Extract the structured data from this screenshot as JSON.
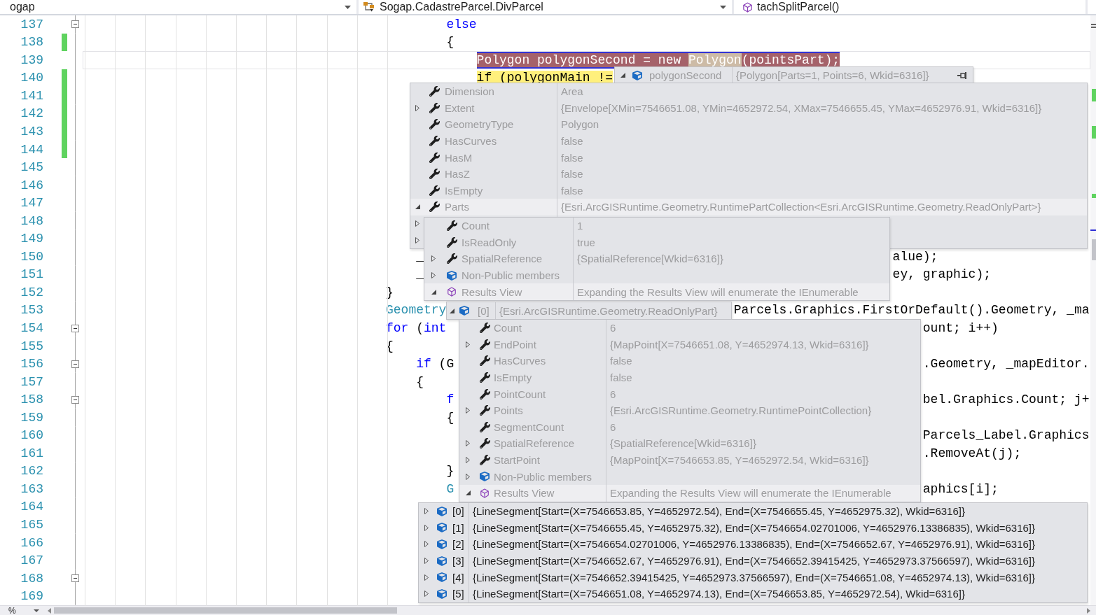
{
  "navbar": [
    {
      "label": "ogap"
    },
    {
      "label": "Sogap.CadastreParcel.DivParcel"
    },
    {
      "label": "tachSplitParcel()"
    }
  ],
  "editor": {
    "lines": [
      {
        "number": "137",
        "changed": false,
        "fold": true,
        "current": false,
        "tokens": [
          {
            "text": "                                                else",
            "kind": "keyword"
          }
        ]
      },
      {
        "number": "138",
        "changed": true,
        "fold": false,
        "current": false,
        "tokens": [
          {
            "text": "                                                {",
            "kind": "plain"
          }
        ]
      },
      {
        "number": "139",
        "changed": false,
        "fold": false,
        "current": true,
        "tokens": [
          {
            "text": "                                                    Polygon polygonSecond = new ",
            "kind": "statement"
          },
          {
            "text": "Polygon",
            "kind": "reference"
          },
          {
            "text": "(pointsPart);",
            "kind": "statement"
          }
        ]
      },
      {
        "number": "140",
        "changed": true,
        "fold": false,
        "current": false,
        "tokens": [
          {
            "text": "                                                    if (polygonMain !=",
            "kind": "current"
          }
        ]
      },
      {
        "number": "141",
        "changed": true,
        "fold": false,
        "current": false
      },
      {
        "number": "142",
        "changed": true,
        "fold": false,
        "current": false
      },
      {
        "number": "143",
        "changed": true,
        "fold": false,
        "current": false
      },
      {
        "number": "144",
        "changed": true,
        "fold": false,
        "current": false
      },
      {
        "number": "145",
        "changed": false,
        "fold": false,
        "current": false
      },
      {
        "number": "146",
        "changed": false,
        "fold": false,
        "current": false
      },
      {
        "number": "147",
        "changed": false,
        "fold": false,
        "current": false
      },
      {
        "number": "148",
        "changed": false,
        "fold": false,
        "current": false
      },
      {
        "number": "149",
        "changed": false,
        "fold": false,
        "current": false
      },
      {
        "number": "150",
        "changed": false,
        "fold": false,
        "current": false,
        "tokens": [
          {
            "text": "                                            _",
            "kind": "plain"
          },
          {
            "text": "                                                              alue);",
            "kind": "plain"
          }
        ]
      },
      {
        "number": "151",
        "changed": false,
        "fold": false,
        "current": false,
        "tokens": [
          {
            "text": "                                            _",
            "kind": "plain"
          },
          {
            "text": "                                                              ey, graphic);",
            "kind": "plain"
          }
        ]
      },
      {
        "number": "152",
        "changed": false,
        "fold": false,
        "current": false,
        "tokens": [
          {
            "text": "                                        }",
            "kind": "plain"
          }
        ]
      },
      {
        "number": "153",
        "changed": false,
        "fold": false,
        "current": false,
        "tokens": [
          {
            "text": "                                        Geometry",
            "kind": "type"
          },
          {
            "text": "                                      Parcels.Graphics.FirstOrDefault().Geometry, _ma",
            "kind": "plain"
          }
        ]
      },
      {
        "number": "154",
        "changed": false,
        "fold": true,
        "current": false,
        "tokens": [
          {
            "text": "                                        for",
            "kind": "keyword"
          },
          {
            "text": " (",
            "kind": "plain"
          },
          {
            "text": "int",
            "kind": "keyword"
          },
          {
            "text": "                                                               ount; i++)",
            "kind": "plain"
          }
        ]
      },
      {
        "number": "155",
        "changed": false,
        "fold": false,
        "current": false,
        "tokens": [
          {
            "text": "                                        {",
            "kind": "plain"
          }
        ]
      },
      {
        "number": "156",
        "changed": false,
        "fold": true,
        "current": false,
        "tokens": [
          {
            "text": "                                            if",
            "kind": "keyword"
          },
          {
            "text": " (G",
            "kind": "plain"
          },
          {
            "text": "                                                              .Geometry, _mapEditor.",
            "kind": "plain"
          }
        ]
      },
      {
        "number": "157",
        "changed": false,
        "fold": false,
        "current": false,
        "tokens": [
          {
            "text": "                                            {",
            "kind": "plain"
          }
        ]
      },
      {
        "number": "158",
        "changed": false,
        "fold": true,
        "current": false,
        "tokens": [
          {
            "text": "                                                f",
            "kind": "keyword"
          },
          {
            "text": "                                                              bel.Graphics.Count; j+",
            "kind": "plain"
          }
        ]
      },
      {
        "number": "159",
        "changed": false,
        "fold": false,
        "current": false,
        "tokens": [
          {
            "text": "                                                {",
            "kind": "plain"
          }
        ]
      },
      {
        "number": "160",
        "changed": false,
        "fold": false,
        "current": false,
        "tokens": [
          {
            "text": "                                                                                                               Parcels_Label.Graphics",
            "kind": "plain"
          }
        ]
      },
      {
        "number": "161",
        "changed": false,
        "fold": false,
        "current": false,
        "tokens": [
          {
            "text": "                                                                                                               .RemoveAt(j);",
            "kind": "plain"
          }
        ]
      },
      {
        "number": "162",
        "changed": false,
        "fold": false,
        "current": false,
        "tokens": [
          {
            "text": "                                                }",
            "kind": "plain"
          }
        ]
      },
      {
        "number": "163",
        "changed": false,
        "fold": false,
        "current": false,
        "tokens": [
          {
            "text": "                                                G",
            "kind": "type"
          },
          {
            "text": "                                                              aphics[i];",
            "kind": "plain"
          }
        ]
      },
      {
        "number": "164",
        "changed": false,
        "fold": false,
        "current": false
      },
      {
        "number": "165",
        "changed": false,
        "fold": false,
        "current": false
      },
      {
        "number": "166",
        "changed": false,
        "fold": false,
        "current": false
      },
      {
        "number": "167",
        "changed": false,
        "fold": false,
        "current": false
      },
      {
        "number": "168",
        "changed": false,
        "fold": true,
        "current": false
      },
      {
        "number": "169",
        "changed": false,
        "fold": false,
        "current": false
      }
    ]
  },
  "datatips": [
    {
      "kind": "header",
      "faded": true,
      "expanded": true,
      "name": "polygonSecond",
      "value": "{Polygon[Parts=1, Points=6, Wkid=6316]}",
      "pin": true
    },
    {
      "kind": "list",
      "faded": true,
      "rows": [
        {
          "kind": "property",
          "name": "Dimension",
          "value": "Area"
        },
        {
          "kind": "property",
          "expanded": false,
          "name": "Extent",
          "value": "{Envelope[XMin=7546651.08, YMin=4652972.54, XMax=7546655.45, YMax=4652976.91, Wkid=6316]}"
        },
        {
          "kind": "property",
          "name": "GeometryType",
          "value": "Polygon"
        },
        {
          "kind": "property",
          "name": "HasCurves",
          "value": "false"
        },
        {
          "kind": "property",
          "name": "HasM",
          "value": "false"
        },
        {
          "kind": "property",
          "name": "HasZ",
          "value": "false"
        },
        {
          "kind": "property",
          "name": "IsEmpty",
          "value": "false"
        },
        {
          "kind": "property",
          "expanded": true,
          "name": "Parts",
          "value": "{Esri.ArcGISRuntime.Geometry.RuntimePartCollection<Esri.ArcGISRuntime.Geometry.ReadOnlyPart>}"
        },
        {
          "kind": "hidden",
          "expanded": false
        },
        {
          "kind": "hidden",
          "expanded": false
        }
      ]
    },
    {
      "kind": "list",
      "faded": true,
      "rows": [
        {
          "kind": "property",
          "name": "Count",
          "value": "1"
        },
        {
          "kind": "property",
          "name": "IsReadOnly",
          "value": "true"
        },
        {
          "kind": "property",
          "expanded": false,
          "name": "SpatialReference",
          "value": "{SpatialReference[Wkid=6316]}"
        },
        {
          "kind": "object",
          "expanded": false,
          "name": "Non-Public members"
        },
        {
          "kind": "view",
          "expanded": true,
          "name": "Results View",
          "value": "Expanding the Results View will enumerate the IEnumerable"
        }
      ]
    },
    {
      "kind": "header",
      "faded": true,
      "expanded": true,
      "name": "[0]",
      "value": "{Esri.ArcGISRuntime.Geometry.ReadOnlyPart}",
      "pin": false
    },
    {
      "kind": "list",
      "faded": true,
      "rows": [
        {
          "kind": "property",
          "name": "Count",
          "value": "6"
        },
        {
          "kind": "property",
          "expanded": false,
          "name": "EndPoint",
          "value": "{MapPoint[X=7546651.08, Y=4652974.13, Wkid=6316]}"
        },
        {
          "kind": "property",
          "name": "HasCurves",
          "value": "false"
        },
        {
          "kind": "property",
          "name": "IsEmpty",
          "value": "false"
        },
        {
          "kind": "property",
          "name": "PointCount",
          "value": "6"
        },
        {
          "kind": "property",
          "expanded": false,
          "name": "Points",
          "value": "{Esri.ArcGISRuntime.Geometry.RuntimePointCollection}"
        },
        {
          "kind": "property",
          "name": "SegmentCount",
          "value": "6"
        },
        {
          "kind": "property",
          "expanded": false,
          "name": "SpatialReference",
          "value": "{SpatialReference[Wkid=6316]}"
        },
        {
          "kind": "property",
          "expanded": false,
          "name": "StartPoint",
          "value": "{MapPoint[X=7546653.85, Y=4652972.54, Wkid=6316]}"
        },
        {
          "kind": "object",
          "expanded": false,
          "name": "Non-Public members"
        },
        {
          "kind": "view",
          "expanded": true,
          "name": "Results View",
          "value": "Expanding the Results View will enumerate the IEnumerable"
        }
      ]
    },
    {
      "kind": "list",
      "faded": false,
      "rows": [
        {
          "kind": "object",
          "expanded": false,
          "name": "[0]",
          "value": "{LineSegment[Start=(X=7546653.85, Y=4652972.54), End=(X=7546655.45, Y=4652975.32), Wkid=6316]}"
        },
        {
          "kind": "object",
          "expanded": false,
          "name": "[1]",
          "value": "{LineSegment[Start=(X=7546655.45, Y=4652975.32), End=(X=7546654.02701006, Y=4652976.13386835), Wkid=6316]}"
        },
        {
          "kind": "object",
          "expanded": false,
          "name": "[2]",
          "value": "{LineSegment[Start=(X=7546654.02701006, Y=4652976.13386835), End=(X=7546652.67, Y=4652976.91), Wkid=6316]}"
        },
        {
          "kind": "object",
          "expanded": false,
          "name": "[3]",
          "value": "{LineSegment[Start=(X=7546652.67, Y=4652976.91), End=(X=7546652.39415425, Y=4652973.37566597), Wkid=6316]}"
        },
        {
          "kind": "object",
          "expanded": false,
          "name": "[4]",
          "value": "{LineSegment[Start=(X=7546652.39415425, Y=4652973.37566597), End=(X=7546651.08, Y=4652974.13), Wkid=6316]}"
        },
        {
          "kind": "object",
          "expanded": false,
          "name": "[5]",
          "value": "{LineSegment[Start=(X=7546651.08, Y=4652974.13), End=(X=7546653.85, Y=4652972.54), Wkid=6316]}"
        }
      ]
    }
  ],
  "status_bar": {
    "zoom": "%"
  }
}
